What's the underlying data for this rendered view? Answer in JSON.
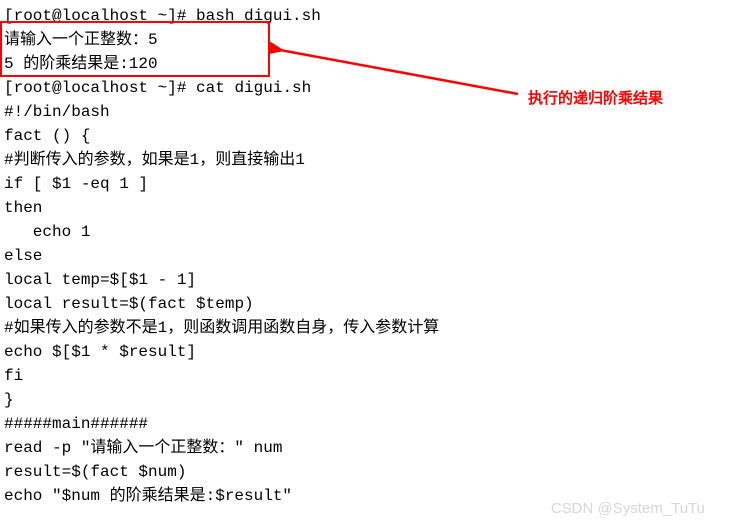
{
  "terminal": {
    "lines": [
      "[root@localhost ~]# bash digui.sh",
      "请输入一个正整数：5",
      "5 的阶乘结果是:120",
      "[root@localhost ~]# cat digui.sh",
      "#!/bin/bash",
      "fact () {",
      "#判断传入的参数，如果是1，则直接输出1",
      "if [ $1 -eq 1 ]",
      "then",
      "   echo 1",
      "else",
      "local temp=$[$1 - 1]",
      "local result=$(fact $temp)",
      "#如果传入的参数不是1，则函数调用函数自身，传入参数计算",
      "echo $[$1 * $result]",
      "fi",
      "}",
      "#####main######",
      "read -p \"请输入一个正整数：\" num",
      "result=$(fact $num)",
      "echo \"$num 的阶乘结果是:$result\""
    ]
  },
  "annotation_text": "执行的递归阶乘结果",
  "watermark": "CSDN @System_TuTu"
}
